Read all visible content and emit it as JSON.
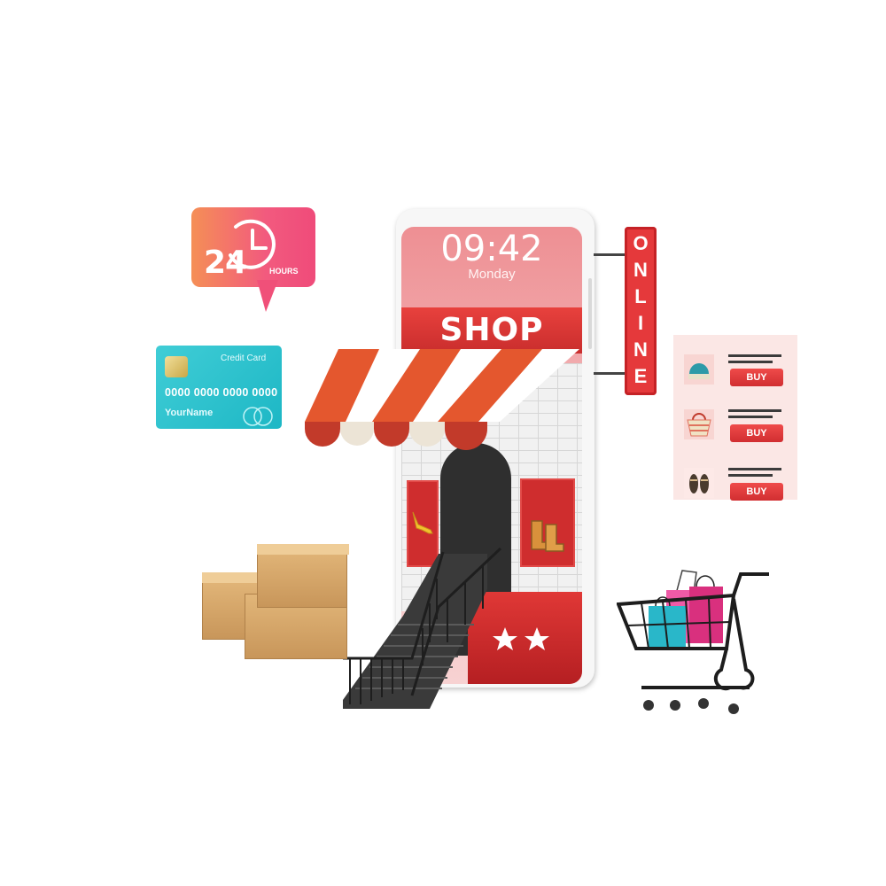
{
  "hours_bubble": {
    "number": "24",
    "unit": "HOURS",
    "colors": {
      "start": "#f58f56",
      "end": "#ef4b7a"
    }
  },
  "credit_card": {
    "label": "Credit Card",
    "number": "0000 0000 0000 0000",
    "name": "YourName",
    "color": "#1db7c5"
  },
  "phone": {
    "time": "09:42",
    "day": "Monday",
    "shop_label": "SHOP",
    "accent": "#e5393b"
  },
  "online_sign": {
    "letters": [
      "O",
      "N",
      "L",
      "I",
      "N",
      "E"
    ]
  },
  "product_panel": {
    "items": [
      {
        "icon": "beanie-hat-icon",
        "buy_label": "BUY"
      },
      {
        "icon": "tote-bag-icon",
        "buy_label": "BUY"
      },
      {
        "icon": "sandals-icon",
        "buy_label": "BUY"
      }
    ]
  },
  "icons": [
    "clock-icon",
    "chip-icon",
    "mastercard-icon",
    "high-heel-icon",
    "boots-icon",
    "star-icon",
    "cart-icon",
    "shopping-bags-icon",
    "cardboard-box-icon",
    "staircase-icon",
    "awning-icon"
  ]
}
